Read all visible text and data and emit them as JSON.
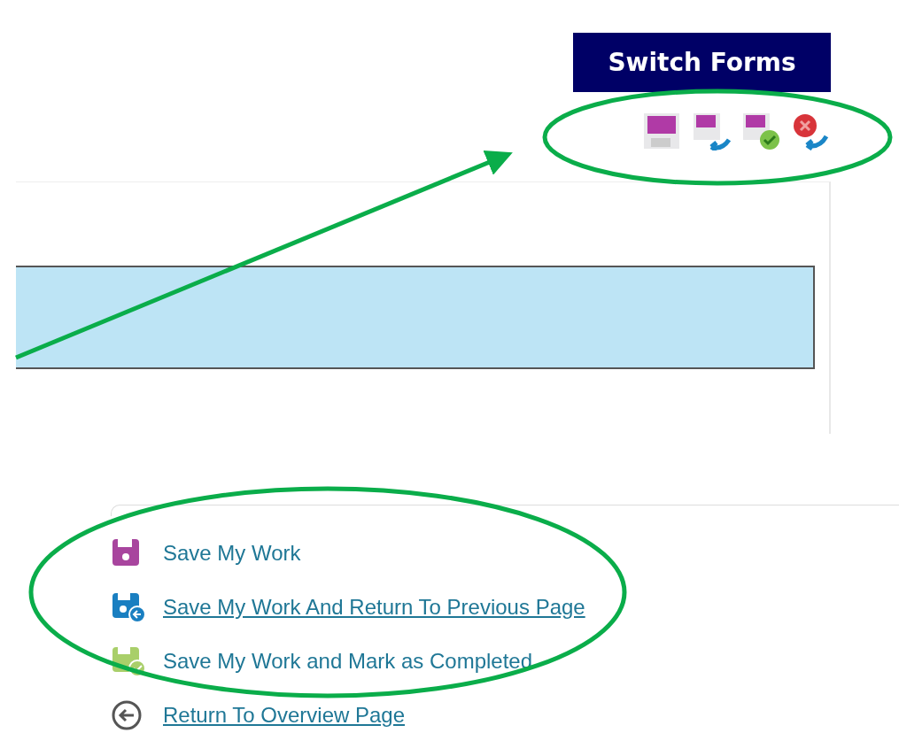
{
  "switch_forms_button": "Switch Forms",
  "toolbar_icons": [
    {
      "kind": "save"
    },
    {
      "kind": "save-return"
    },
    {
      "kind": "save-complete"
    },
    {
      "kind": "cancel-return"
    }
  ],
  "links": [
    {
      "kind": "save",
      "label": "Save My Work",
      "underlined": false
    },
    {
      "kind": "save-return",
      "label": "Save My Work And Return To Previous Page",
      "underlined": true
    },
    {
      "kind": "save-complete",
      "label": "Save My Work and Mark as Completed",
      "underlined": false
    },
    {
      "kind": "back",
      "label": "Return To Overview Page",
      "underlined": true
    }
  ]
}
